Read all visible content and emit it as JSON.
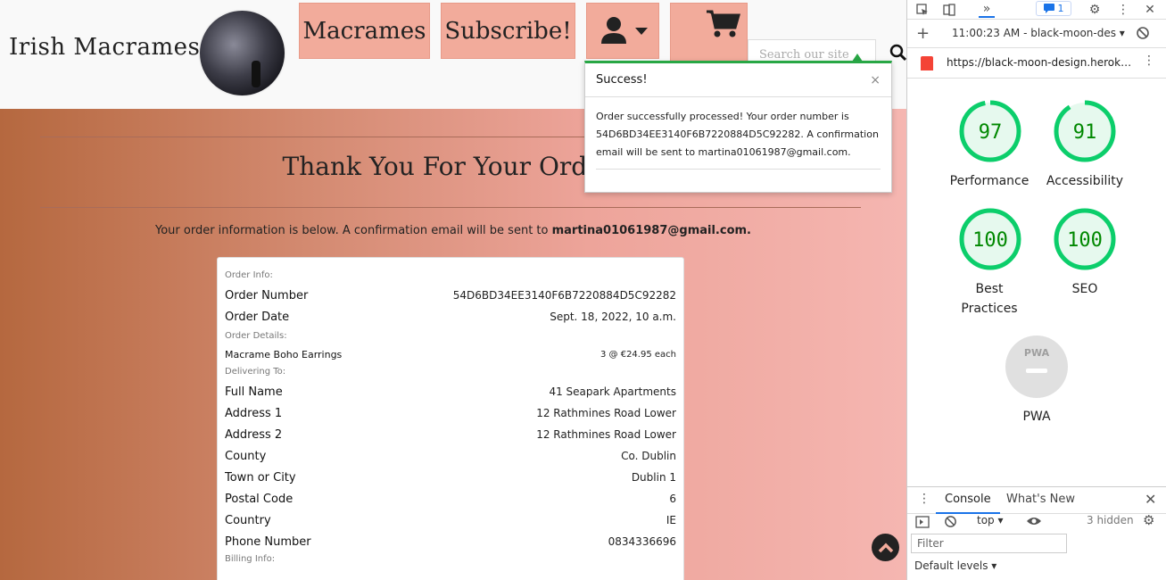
{
  "site": {
    "brand": "Irish Macrames",
    "nav": {
      "macrames": "Macrames",
      "subscribe": "Subscribe!"
    },
    "search_placeholder": "Search our site",
    "heading": "Thank You For Your Order!",
    "info_prefix": "Your order information is below. A confirmation email will be sent to ",
    "email": "martina01061987@gmail.com.",
    "order": {
      "section_info": "Order Info:",
      "number_label": "Order Number",
      "number": "54D6BD34EE3140F6B7220884D5C92282",
      "date_label": "Order Date",
      "date": "Sept. 18, 2022, 10 a.m.",
      "section_details": "Order Details:",
      "item_name": "Macrame Boho Earrings",
      "item_qty": "3 @ €24.95 each",
      "section_delivering": "Delivering To:",
      "rows": [
        {
          "k": "Full Name",
          "v": "41 Seapark Apartments"
        },
        {
          "k": "Address 1",
          "v": "12 Rathmines Road Lower"
        },
        {
          "k": "Address 2",
          "v": "12 Rathmines Road Lower"
        },
        {
          "k": "County",
          "v": "Co. Dublin"
        },
        {
          "k": "Town or City",
          "v": "Dublin 1"
        },
        {
          "k": "Postal Code",
          "v": "6"
        },
        {
          "k": "Country",
          "v": "IE"
        },
        {
          "k": "Phone Number",
          "v": "0834336696"
        }
      ],
      "section_billing": "Billing Info:"
    }
  },
  "toast": {
    "title": "Success!",
    "close": "×",
    "body": "Order successfully processed! Your order number is 54D6BD34EE3140F6B7220884D5C92282. A confirmation email will be sent to martina01061987@gmail.com."
  },
  "devtools": {
    "badge_count": "1",
    "session": "11:00:23 AM - black-moon-des ▾",
    "url": "https://black-moon-design.herok…",
    "scores": [
      {
        "name": "Performance",
        "value": "97",
        "fraction": 0.97
      },
      {
        "name": "Accessibility",
        "value": "91",
        "fraction": 0.91
      },
      {
        "name": "Best Practices",
        "value": "100",
        "fraction": 1.0
      },
      {
        "name": "SEO",
        "value": "100",
        "fraction": 1.0
      }
    ],
    "pwa_label": "PWA",
    "pwa_badge": "PWA",
    "drawer": {
      "console_tab": "Console",
      "whatsnew_tab": "What's New",
      "context": "top ▾",
      "hidden": "3 hidden",
      "filter_placeholder": "Filter",
      "levels": "Default levels ▾"
    },
    "colors": {
      "pass": "#0cce6b",
      "pass_bg": "#e6f9ee",
      "pass_text": "#008800"
    }
  }
}
